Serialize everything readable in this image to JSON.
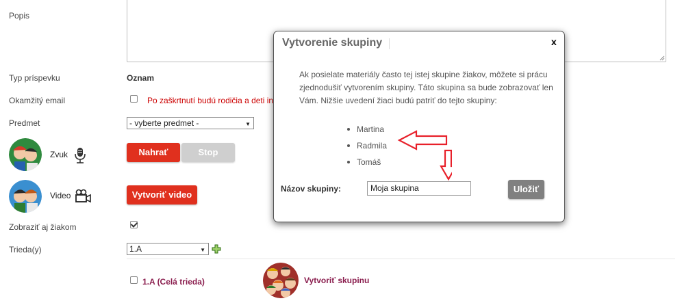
{
  "form": {
    "description_label": "Popis",
    "post_type_label": "Typ príspevku",
    "post_type_value": "Oznam",
    "instant_email_label": "Okamžitý email",
    "instant_email_note": "Po zaškrtnutí budú rodičia a deti in",
    "subject_label": "Predmet",
    "subject_value": "- vyberte predmet -",
    "sound_label": "Zvuk",
    "record_button": "Nahrať",
    "stop_button": "Stop",
    "video_label": "Video",
    "create_video_button": "Vytvoriť video",
    "show_students_label": "Zobraziť aj žiakom",
    "class_label": "Trieda(y)",
    "class_value": "1.A",
    "whole_class_label": "1.A (Celá trieda)",
    "create_group_link": "Vytvoriť skupinu"
  },
  "modal": {
    "title": "Vytvorenie skupiny",
    "close": "x",
    "description": "Ak posielate materiály často tej istej skupine žiakov, môžete si prácu zjednodušiť vytvorením skupiny. Táto skupina sa bude zobrazovať len Vám. Nižšie uvedení žiaci budú patriť do tejto skupiny:",
    "students": [
      "Martina",
      "Radmila",
      "Tomáš"
    ],
    "group_name_label": "Názov skupiny:",
    "group_name_value": "Moja skupina",
    "save_button": "Uložiť"
  },
  "colors": {
    "accent_red": "#e0301e",
    "annotation_red": "#e8202a",
    "link_purple": "#8b1f4f"
  }
}
